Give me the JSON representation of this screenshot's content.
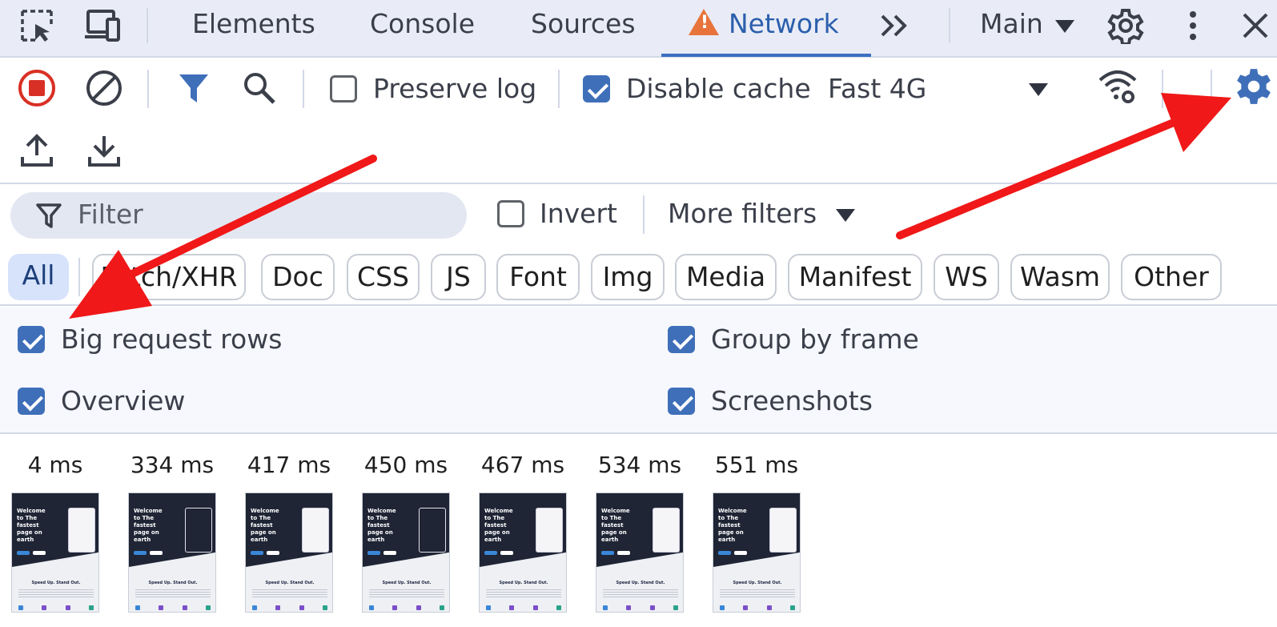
{
  "tabs": {
    "items": [
      "Elements",
      "Console",
      "Sources",
      "Network"
    ],
    "active": "Network",
    "context": "Main"
  },
  "toolbar": {
    "preserve_log": {
      "label": "Preserve log",
      "checked": false
    },
    "disable_cache": {
      "label": "Disable cache",
      "checked": true
    },
    "throttling": "Fast 4G"
  },
  "filter": {
    "placeholder": "Filter",
    "invert": {
      "label": "Invert",
      "checked": false
    },
    "more_filters": "More filters"
  },
  "type_filters": [
    "All",
    "Fetch/XHR",
    "Doc",
    "CSS",
    "JS",
    "Font",
    "Img",
    "Media",
    "Manifest",
    "WS",
    "Wasm",
    "Other"
  ],
  "settings": {
    "big_request_rows": {
      "label": "Big request rows",
      "checked": true
    },
    "group_by_frame": {
      "label": "Group by frame",
      "checked": true
    },
    "overview": {
      "label": "Overview",
      "checked": true
    },
    "screenshots": {
      "label": "Screenshots",
      "checked": true
    }
  },
  "filmstrip": {
    "frames": [
      {
        "time": "4 ms"
      },
      {
        "time": "334 ms"
      },
      {
        "time": "417 ms"
      },
      {
        "time": "450 ms"
      },
      {
        "time": "467 ms"
      },
      {
        "time": "534 ms"
      },
      {
        "time": "551 ms"
      }
    ],
    "thumbnail_text": {
      "hero_title": "Welcome to The fastest page on earth",
      "tagline": "Speed Up. Stand Out."
    }
  },
  "colors": {
    "accent": "#3f6fb9",
    "record": "#d93025",
    "warning": "#e8743b",
    "annotation_arrow": "#f01818"
  }
}
